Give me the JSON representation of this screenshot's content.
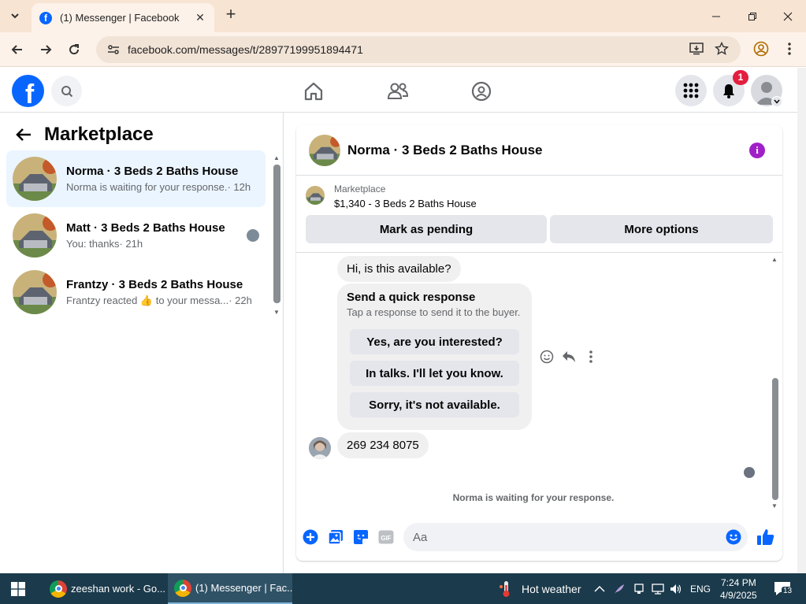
{
  "browser": {
    "tab_title": "(1) Messenger | Facebook",
    "url": "facebook.com/messages/t/28977199951894471"
  },
  "header": {
    "notification_count": "1"
  },
  "left_panel": {
    "title": "Marketplace",
    "conversations": [
      {
        "name": "Norma · 3 Beds 2 Baths House",
        "preview": "Norma is waiting for your response.",
        "time": "· 12h"
      },
      {
        "name": "Matt · 3 Beds 2 Baths House",
        "preview": "You: thanks",
        "time": "· 21h"
      },
      {
        "name": "Frantzy · 3 Beds 2 Baths House",
        "preview": "Frantzy reacted 👍 to your messa...",
        "time": "· 22h"
      }
    ]
  },
  "chat": {
    "title": "Norma · 3 Beds 2 Baths House",
    "listing_category": "Marketplace",
    "listing_title": "$1,340 - 3 Beds 2 Baths House",
    "mark_pending": "Mark as pending",
    "more_options": "More options",
    "message_1": "Hi, is this available?",
    "quick_response_title": "Send a quick response",
    "quick_response_subtitle": "Tap a response to send it to the buyer.",
    "quick_responses": [
      "Yes, are you interested?",
      "In talks. I'll let you know.",
      "Sorry, it's not available."
    ],
    "message_2": "269 234 8075",
    "waiting_text": "Norma is waiting for your response.",
    "composer_placeholder": "Aa"
  },
  "taskbar": {
    "app_1": "zeeshan work - Go...",
    "app_2": "(1) Messenger | Fac...",
    "weather": "Hot weather",
    "language": "ENG",
    "time": "7:24 PM",
    "date": "4/9/2025",
    "notification_count": "13"
  },
  "colors": {
    "facebook_blue": "#0866ff",
    "active_conversation_bg": "#ebf5ff",
    "info_purple": "#a020c7",
    "badge_red": "#e41e3f",
    "taskbar": "#1b3a4b"
  }
}
